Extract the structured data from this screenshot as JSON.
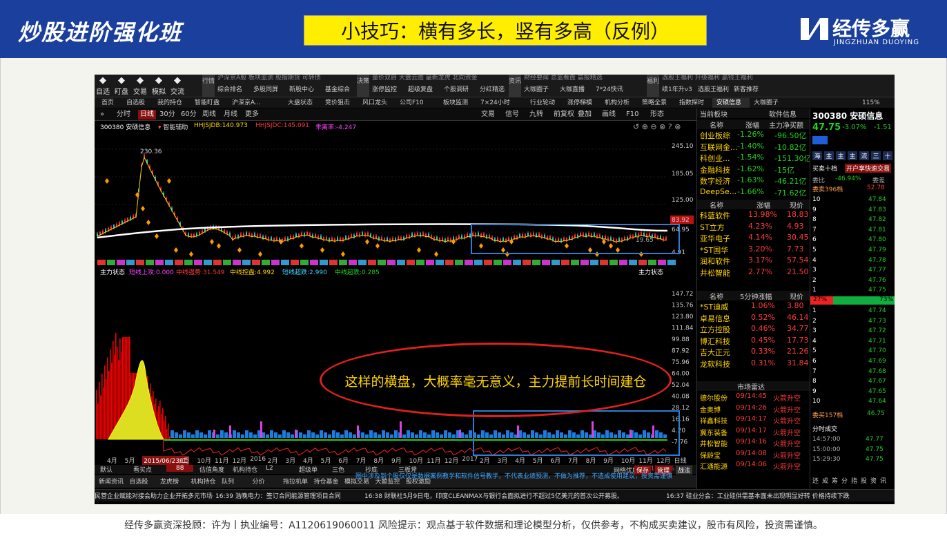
{
  "banner": {
    "brand": "炒股进阶强化班",
    "headline": "小技巧：横有多长，竖有多高（反例）",
    "logo_cn": "经传多赢",
    "logo_en": "JINGZHUAN DUOYING",
    "color": "#1a3f9c",
    "highlight": "#ffee00"
  },
  "toolbar": {
    "icons": [
      {
        "label": "自选",
        "icon": "star-icon"
      },
      {
        "label": "盯盘",
        "icon": "eye-icon"
      },
      {
        "label": "交易",
        "icon": "trade-icon"
      },
      {
        "label": "模拟",
        "icon": "sim-icon"
      },
      {
        "label": "交流",
        "icon": "chat-icon"
      }
    ],
    "group1_tag": "行情",
    "group1_row1": "沪深京A股  板块监测  股指期货  可转债",
    "group1_row2": [
      "综合排名",
      "多股同屏",
      "新股中心",
      "基金综合"
    ],
    "group2_tag": "决策",
    "group2_row1": "量价双启  大盘云图  最新龙虎  北向资金",
    "group2_row2": [
      "涨停监控",
      "超级复盘",
      "个股调研",
      "分红精选"
    ],
    "group3_tag": "资讯",
    "group3_row1": "财经要闻  总监看盘  晨报精选",
    "group3_row2": [
      "大咖圈子",
      "大咖直播",
      "7*24快讯"
    ],
    "group4_tag": "福利",
    "group4_row1": "选股王福利  升级福利  赢钱王福利",
    "group4_row2": [
      "续1年升v3",
      "选股王福利",
      "新客推荐"
    ]
  },
  "tabs": [
    "首页",
    "自选股",
    "我的持仓",
    "智能盯盘",
    "沪深京A...",
    "大盘状态",
    "竞价狙击",
    "风口龙头",
    "公司F10",
    "板块监测",
    "7×24小时",
    "行业轮动",
    "涨停梯模",
    "机构分析",
    "策略全景",
    "指数探时",
    "安硕信息",
    "大咖圈子"
  ],
  "tabs_zoom": "115%",
  "chart_toolbar": {
    "left": [
      "分时",
      "日线",
      "30分",
      "60分",
      "周线",
      "月线",
      "更多"
    ],
    "right": [
      "交易",
      "信号",
      "九转",
      "前复权",
      "叠加",
      "画线",
      "F10",
      "形态"
    ]
  },
  "info_row": {
    "name": "300380 安硕信息",
    "assist": "智能辅助",
    "hhjsjdb": "HHJSJDB:140.973",
    "hhjsjdc": "HHJSJDC:145.091",
    "rate": "乖离率:-4.247"
  },
  "price_axis": [
    "245.10",
    "185.05",
    "125.00",
    "83.92",
    "64.95",
    "4.91"
  ],
  "peak_label": "230.36",
  "low_label": "19.65",
  "indicator": {
    "title": "主力状态",
    "s1": "短线上攻:0.000",
    "s2": "中线强势:31.549",
    "s3": "中线控盘:4.992",
    "s4": "短线超跌:2.990",
    "s5": "中线超跌:0.285",
    "right": "主力状态"
  },
  "osc_axis": [
    "147.72",
    "135.76",
    "123.80",
    "111.84",
    "99.88",
    "87.92",
    "75.96",
    "64.00",
    "52.04",
    "40.08",
    "28.12",
    "16.16",
    "4.20",
    "-7.76"
  ],
  "dates": [
    "4月",
    "5月",
    "2015/06/23/二",
    "9月",
    "10月",
    "11月",
    "12月",
    "2016",
    "2月",
    "3月",
    "4月",
    "5月",
    "6月",
    "7月",
    "8月",
    "9月",
    "10月",
    "11月",
    "12月",
    "2017",
    "2月",
    "3月",
    "4月",
    "5月",
    "6月",
    "7月",
    "8月",
    "9月",
    "10月",
    "11月",
    "12月",
    "日线"
  ],
  "bottom1": [
    "默认",
    "看买点",
    "88",
    "估值角度",
    "机构持仓",
    "L2",
    "超级单",
    "三色",
    "抄底",
    "三板斧"
  ],
  "bottom2": [
    "新闻资讯",
    "自选股",
    "龙虎榜",
    "机构持仓",
    "队列",
    "分价",
    "拖拉机单",
    "持仓基金",
    "模拟交易",
    "大额监控",
    "股权激励"
  ],
  "bottom_right": [
    "保存",
    "管理",
    "战法"
  ],
  "net_status": "网络优质",
  "net_pct": "+18.74%",
  "news": [
    "民营企业赋能对接会助力企业开拓多元市场",
    "16:39 浩晚电力：签订合同能源管理项目合同",
    "16:38 财联社5月9日电，印度CLEANMAX与银行会面拟进行不超过5亿美元的首次公开募股。",
    "16:37 硅业分会：工业硅供需基本面未出现明显好转 价格持续下跌"
  ],
  "sector": {
    "title": "当前板块",
    "soft": "软件信息",
    "cols": [
      "名称",
      "涨幅",
      "主力净买额"
    ],
    "rows": [
      [
        "创业板综",
        "-1.26%",
        "-96.50亿"
      ],
      [
        "互联网金...",
        "-1.40%",
        "-10.82亿"
      ],
      [
        "科创业...",
        "-1.54%",
        "-151.30亿"
      ],
      [
        "金融科技",
        "-1.62%",
        "-15亿"
      ],
      [
        "数字经济",
        "-1.63%",
        "-46.21亿"
      ],
      [
        "DeepSe...",
        "-1.66%",
        "-71.62亿"
      ]
    ]
  },
  "gainers": {
    "cols": [
      "名称",
      "涨幅",
      "现价"
    ],
    "rows": [
      [
        "科蓝软件",
        "13.98%",
        "18.83"
      ],
      [
        "ST立方",
        "4.23%",
        "4.93"
      ],
      [
        "亚华电子",
        "4.14%",
        "30.45"
      ],
      [
        "*ST国华",
        "3.20%",
        "7.73"
      ],
      [
        "润和软件",
        "3.17%",
        "57.54"
      ],
      [
        "井松智能",
        "2.77%",
        "21.50"
      ]
    ]
  },
  "speed": {
    "cols": [
      "名称",
      "5分钟涨幅",
      "现价"
    ],
    "rows": [
      [
        "*ST迪威",
        "1.06%",
        "3.80"
      ],
      [
        "卓易信息",
        "0.52%",
        "46.14"
      ],
      [
        "立方控股",
        "0.46%",
        "34.77"
      ],
      [
        "博汇科技",
        "0.45%",
        "17.73"
      ],
      [
        "吉大正元",
        "0.33%",
        "21.26"
      ],
      [
        "龙软科技",
        "0.31%",
        "31.84"
      ]
    ]
  },
  "radar": {
    "title": "市场雷达",
    "rows": [
      [
        "德尔股份",
        "09/14:45",
        "火箭升空"
      ],
      [
        "金奥博",
        "09/14:26",
        "火箭升空"
      ],
      [
        "祥鑫科技",
        "09/14:17",
        "火箭升空"
      ],
      [
        "冀东装备",
        "09/14:17",
        "火箭升空"
      ],
      [
        "井松智能",
        "09/14:16",
        "火箭升空"
      ],
      [
        "保龄宝",
        "09/14:08",
        "火箭升空"
      ],
      [
        "汇通能源",
        "09/14:06",
        "火箭升空"
      ]
    ]
  },
  "quote": {
    "code_name": "300380 安硕信息",
    "price": "47.75",
    "chg": "-3.07%",
    "chg_amt": "-1.51",
    "tags": [
      "海",
      "主",
      "主",
      "主",
      "流",
      "三",
      "十"
    ],
    "buy10": "买卖十档",
    "fast": "开户享快速交易",
    "wb_label": "委比",
    "wb": "-46.94%",
    "wc_label": "委差",
    "sell_total": "委卖396档",
    "sell_total_px": "52.78",
    "asks": [
      [
        "10",
        "47.84"
      ],
      [
        "9",
        "47.83"
      ],
      [
        "8",
        "47.82"
      ],
      [
        "7",
        "47.81"
      ],
      [
        "6",
        "47.80"
      ],
      [
        "5",
        "47.79"
      ],
      [
        "4",
        "47.78"
      ],
      [
        "3",
        "47.77"
      ],
      [
        "2",
        "47.76"
      ],
      [
        "1",
        "47.75"
      ]
    ],
    "bar_left": "27%",
    "bar_right": "73%",
    "bids": [
      [
        "1",
        "47.74"
      ],
      [
        "2",
        "47.73"
      ],
      [
        "3",
        "47.72"
      ],
      [
        "4",
        "47.71"
      ],
      [
        "5",
        "47.70"
      ],
      [
        "6",
        "47.69"
      ],
      [
        "7",
        "47.68"
      ],
      [
        "8",
        "47.67"
      ],
      [
        "9",
        "47.65"
      ],
      [
        "10",
        "47.64"
      ]
    ],
    "buy_total": "委买157档",
    "buy_total_px": "46.75",
    "ticks_title": "分时成交",
    "ticks": [
      [
        "14:57:00",
        "47.77"
      ],
      [
        "15:00:00",
        "47.75"
      ],
      [
        "15:29:30",
        "47.75"
      ]
    ],
    "foot": [
      "还",
      "成",
      "筹",
      "分",
      "指",
      "投",
      "资",
      "讯"
    ]
  },
  "overlay": {
    "text": "这样的横盘，大概率毫无意义，主力提前长时间建仓",
    "disclaimer": "图中涉及到个股仅仅是数据案例教学和软件信号教学，不代表业绩预测，不做为推荐，不造成使用建议，投资需谨慎"
  },
  "footer": "经传多赢资深投顾：许为丨执业编号：A1120619060011    风险提示：观点基于软件数据和理论模型分析，仅供参考，不构成买卖建议，股市有风险，投资需谨慎。"
}
